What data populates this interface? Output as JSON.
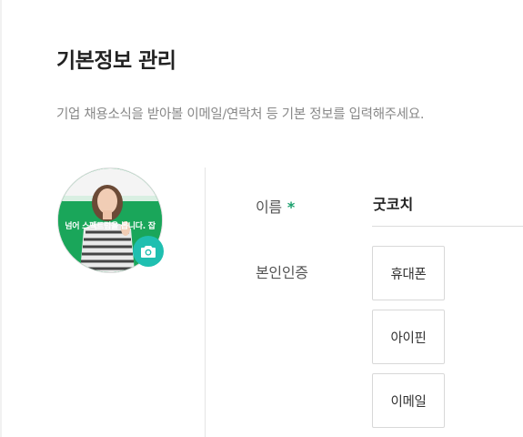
{
  "page": {
    "title": "기본정보 관리",
    "description": "기업 채용소식을 받아볼 이메일/연락처 등 기본 정보를 입력해주세요."
  },
  "profile": {
    "photo_caption": "넘어 스펙트럼을 봅니다. 잡",
    "camera_icon": "camera-icon"
  },
  "form": {
    "name_label": "이름",
    "required_mark": "*",
    "name_value": "굿코치",
    "verification_label": "본인인증",
    "verification_options": [
      "휴대폰",
      "아이핀",
      "이메일"
    ]
  },
  "colors": {
    "accent_green": "#1aa06d",
    "camera_button": "#1fbfb0",
    "photo_background": "#1aa65a"
  }
}
